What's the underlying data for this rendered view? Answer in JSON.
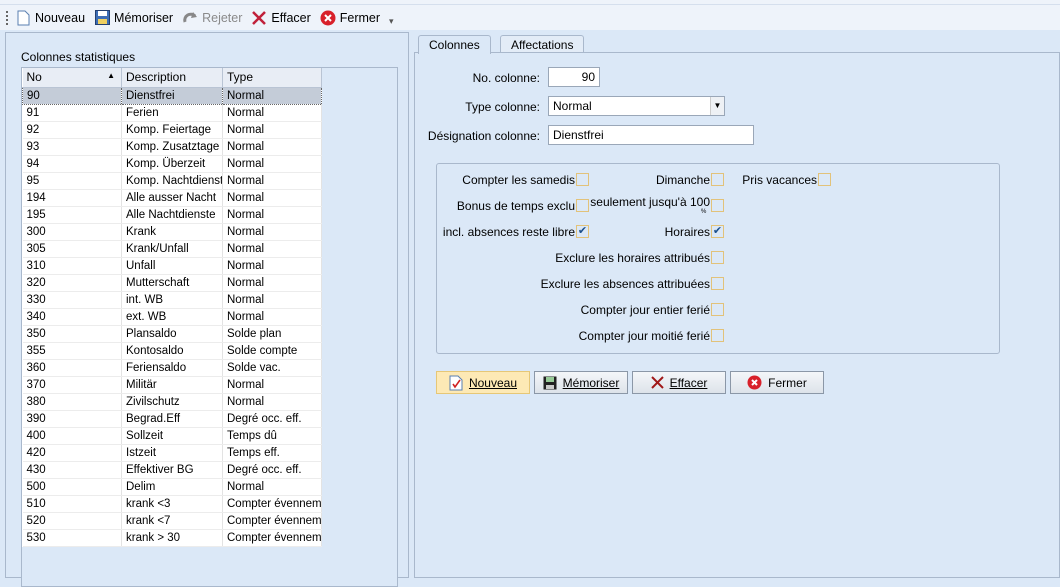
{
  "toolbar": {
    "items": [
      {
        "label": "Nouveau",
        "icon": "new-document-icon"
      },
      {
        "label": "Mémoriser",
        "icon": "save-icon"
      },
      {
        "label": "Rejeter",
        "icon": "undo-icon",
        "disabled": true
      },
      {
        "label": "Effacer",
        "icon": "delete-x-icon"
      },
      {
        "label": "Fermer",
        "icon": "close-circle-icon"
      }
    ]
  },
  "left": {
    "title": "Colonnes statistiques",
    "columns": [
      "No",
      "Description",
      "Type"
    ],
    "rows": [
      [
        "90",
        "Dienstfrei",
        "Normal"
      ],
      [
        "91",
        "Ferien",
        "Normal"
      ],
      [
        "92",
        "Komp. Feiertage",
        "Normal"
      ],
      [
        "93",
        "Komp. Zusatztage",
        "Normal"
      ],
      [
        "94",
        "Komp. Überzeit",
        "Normal"
      ],
      [
        "95",
        "Komp. Nachtdienst",
        "Normal"
      ],
      [
        "194",
        "Alle ausser Nacht",
        "Normal"
      ],
      [
        "195",
        "Alle Nachtdienste",
        "Normal"
      ],
      [
        "300",
        "Krank",
        "Normal"
      ],
      [
        "305",
        "Krank/Unfall",
        "Normal"
      ],
      [
        "310",
        "Unfall",
        "Normal"
      ],
      [
        "320",
        "Mutterschaft",
        "Normal"
      ],
      [
        "330",
        "int. WB",
        "Normal"
      ],
      [
        "340",
        "ext. WB",
        "Normal"
      ],
      [
        "350",
        "Plansaldo",
        "Solde plan"
      ],
      [
        "355",
        "Kontosaldo",
        "Solde compte"
      ],
      [
        "360",
        "Feriensaldo",
        "Solde vac."
      ],
      [
        "370",
        "Militär",
        "Normal"
      ],
      [
        "380",
        "Zivilschutz",
        "Normal"
      ],
      [
        "390",
        "Begrad.Eff",
        "Degré occ. eff."
      ],
      [
        "400",
        "Sollzeit",
        "Temps dû"
      ],
      [
        "420",
        "Istzeit",
        "Temps eff."
      ],
      [
        "430",
        "Effektiver BG",
        "Degré occ. eff."
      ],
      [
        "500",
        "Delim",
        "Normal"
      ],
      [
        "510",
        "krank <3",
        "Compter évennem."
      ],
      [
        "520",
        "krank <7",
        "Compter évennem."
      ],
      [
        "530",
        "krank > 30",
        "Compter évennem."
      ]
    ]
  },
  "tabs": [
    "Colonnes",
    "Affectations"
  ],
  "form": {
    "no_label": "No. colonne:",
    "no_value": "90",
    "type_label": "Type colonne:",
    "type_value": "Normal",
    "des_label": "Désignation colonne:",
    "des_value": "Dienstfrei"
  },
  "checks": [
    {
      "label": "Compter les samedis",
      "checked": false
    },
    {
      "label": "Dimanche",
      "checked": false
    },
    {
      "label": "Pris vacances",
      "checked": false
    },
    {
      "label": "Bonus de temps exclu",
      "checked": false
    },
    {
      "label": "seulement jusqu'à 100",
      "checked": false
    },
    {
      "label": "incl. absences reste libre",
      "checked": true
    },
    {
      "label": "Horaires",
      "checked": true
    },
    {
      "label": "Exclure les horaires attribués",
      "checked": false
    },
    {
      "label": "Exclure les absences attribuées",
      "checked": false
    },
    {
      "label": "Compter jour entier ferié",
      "checked": false
    },
    {
      "label": "Compter jour moitié ferié",
      "checked": false
    }
  ],
  "percent_sign": "%",
  "buttons": {
    "new": "Nouveau",
    "save": "Mémoriser",
    "delete": "Effacer",
    "close": "Fermer"
  }
}
